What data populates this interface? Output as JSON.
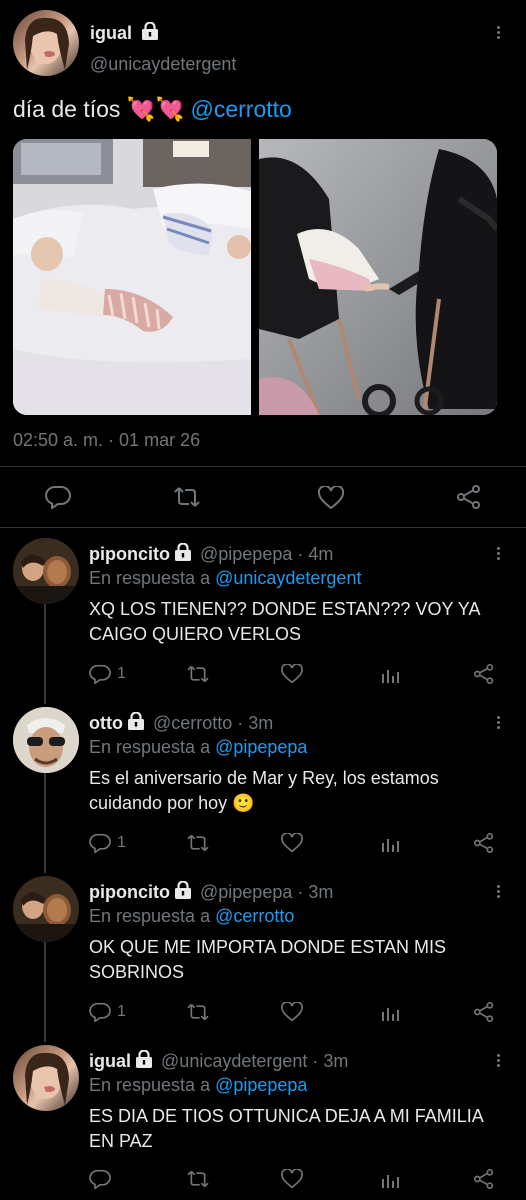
{
  "main_tweet": {
    "name": "igual",
    "handle": "@unicaydetergent",
    "text": "día de tíos",
    "emojis": "💘💘",
    "mention": "@cerrotto",
    "timestamp": "02:50 a. m. · 01 mar 26"
  },
  "replies": [
    {
      "name": "piponcito",
      "meta": "@pipepepa · 4m",
      "reply_label": "En respuesta a",
      "reply_to": "@unicaydetergent",
      "text": "XQ LOS TIENEN?? DONDE ESTAN??? VOY YA CAIGO QUIERO VERLOS",
      "reply_count": "1"
    },
    {
      "name": "otto",
      "meta": "@cerrotto · 3m",
      "reply_label": "En respuesta a",
      "reply_to": "@pipepepa",
      "text": "Es el aniversario de Mar y Rey, los estamos cuidando por hoy 🙂",
      "reply_count": "1"
    },
    {
      "name": "piponcito",
      "meta": "@pipepepa · 3m",
      "reply_label": "En respuesta a",
      "reply_to": "@cerrotto",
      "text": "OK QUE ME IMPORTA DONDE ESTAN MIS SOBRINOS",
      "reply_count": "1"
    },
    {
      "name": "igual",
      "meta": "@unicaydetergent · 3m",
      "reply_label": "En respuesta a",
      "reply_to": "@pipepepa",
      "text": "ES DIA DE TIOS OTTUNICA DEJA A MI FAMILIA EN PAZ",
      "reply_count": ""
    }
  ],
  "colors": {
    "background": "#000000",
    "text": "#e7e9ea",
    "muted": "#71767b",
    "accent": "#1d9bf0",
    "divider": "#2f3336"
  },
  "icons": [
    "lock-icon",
    "more-icon",
    "reply-icon",
    "retweet-icon",
    "like-icon",
    "share-icon",
    "analytics-icon"
  ]
}
